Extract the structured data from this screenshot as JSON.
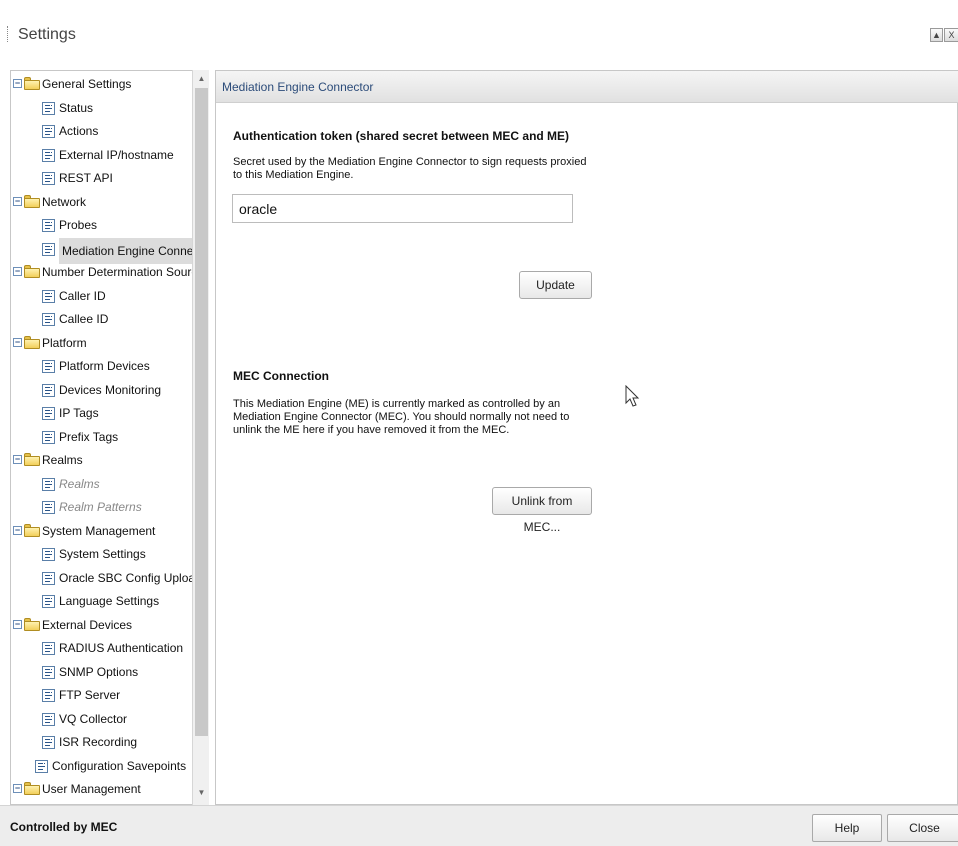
{
  "window": {
    "title": "Settings",
    "maximize_glyph": "▲",
    "close_glyph": "X"
  },
  "tree": {
    "items": [
      {
        "label": "General Settings",
        "level": 0,
        "kind": "folder",
        "expanded": true
      },
      {
        "label": "Status",
        "level": 1,
        "kind": "page"
      },
      {
        "label": "Actions",
        "level": 1,
        "kind": "page"
      },
      {
        "label": "External IP/hostname",
        "level": 1,
        "kind": "page"
      },
      {
        "label": "REST API",
        "level": 1,
        "kind": "page"
      },
      {
        "label": "Network",
        "level": 0,
        "kind": "folder",
        "expanded": true
      },
      {
        "label": "Probes",
        "level": 1,
        "kind": "page"
      },
      {
        "label": "Mediation Engine Connecti",
        "level": 1,
        "kind": "page",
        "selected": true
      },
      {
        "label": "Number Determination Source",
        "level": 0,
        "kind": "folder",
        "expanded": true
      },
      {
        "label": "Caller ID",
        "level": 1,
        "kind": "page"
      },
      {
        "label": "Callee ID",
        "level": 1,
        "kind": "page"
      },
      {
        "label": "Platform",
        "level": 0,
        "kind": "folder",
        "expanded": true
      },
      {
        "label": "Platform Devices",
        "level": 1,
        "kind": "page"
      },
      {
        "label": "Devices Monitoring",
        "level": 1,
        "kind": "page"
      },
      {
        "label": "IP Tags",
        "level": 1,
        "kind": "page"
      },
      {
        "label": "Prefix Tags",
        "level": 1,
        "kind": "page"
      },
      {
        "label": "Realms",
        "level": 0,
        "kind": "folder",
        "expanded": true
      },
      {
        "label": "Realms",
        "level": 1,
        "kind": "page",
        "disabled": true
      },
      {
        "label": "Realm Patterns",
        "level": 1,
        "kind": "page",
        "disabled": true
      },
      {
        "label": "System Management",
        "level": 0,
        "kind": "folder",
        "expanded": true
      },
      {
        "label": "System Settings",
        "level": 1,
        "kind": "page"
      },
      {
        "label": "Oracle SBC Config Upload",
        "level": 1,
        "kind": "page"
      },
      {
        "label": "Language Settings",
        "level": 1,
        "kind": "page"
      },
      {
        "label": "External Devices",
        "level": 0,
        "kind": "folder",
        "expanded": true
      },
      {
        "label": "RADIUS Authentication",
        "level": 1,
        "kind": "page"
      },
      {
        "label": "SNMP Options",
        "level": 1,
        "kind": "page"
      },
      {
        "label": "FTP Server",
        "level": 1,
        "kind": "page"
      },
      {
        "label": "VQ Collector",
        "level": 1,
        "kind": "page"
      },
      {
        "label": "ISR Recording",
        "level": 1,
        "kind": "page"
      },
      {
        "label": "Configuration Savepoints",
        "level": 0,
        "kind": "page"
      },
      {
        "label": "User Management",
        "level": 0,
        "kind": "folder",
        "expanded": true
      }
    ]
  },
  "main": {
    "header": "Mediation Engine Connector",
    "auth": {
      "title": "Authentication token (shared secret between MEC and ME)",
      "desc_line1": "Secret used by the Mediation Engine Connector to sign requests proxied",
      "desc_line2": "to this Mediation Engine.",
      "token_value": "oracle",
      "update_label": "Update"
    },
    "mec": {
      "title": "MEC Connection",
      "desc_line1": "This Mediation Engine (ME) is currently marked as controlled by an",
      "desc_line2": "Mediation Engine Connector (MEC). You should normally not need to",
      "desc_line3": "unlink the ME here if you have removed it from the MEC.",
      "unlink_label": "Unlink from MEC..."
    }
  },
  "footer": {
    "status": "Controlled by MEC",
    "help_label": "Help",
    "close_label": "Close"
  }
}
